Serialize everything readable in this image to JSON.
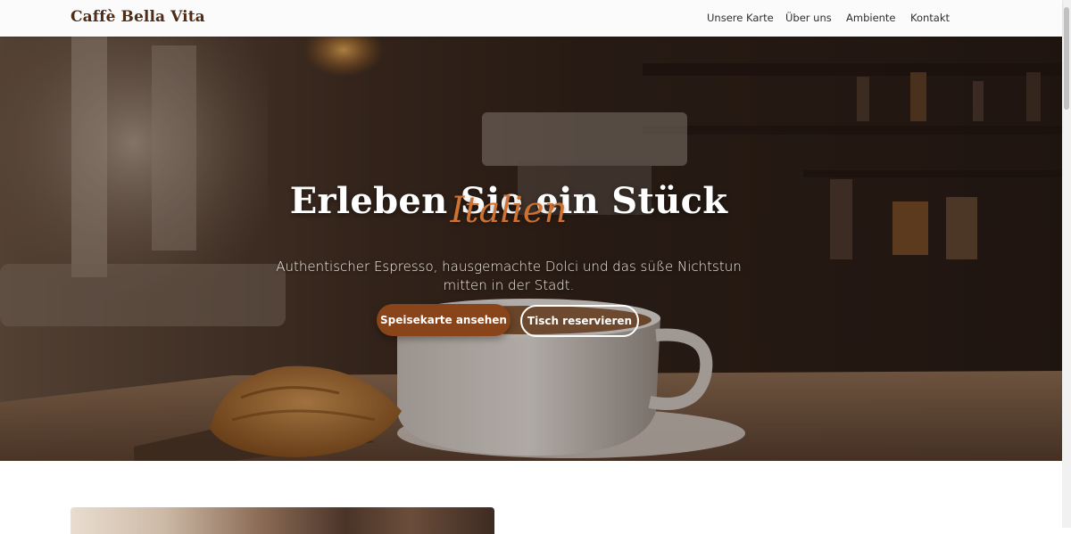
{
  "header": {
    "brand": "Caffè Bella Vita",
    "nav": [
      {
        "label": "Unsere Karte"
      },
      {
        "label": "Über uns"
      },
      {
        "label": "Ambiente"
      },
      {
        "label": "Kontakt"
      }
    ]
  },
  "hero": {
    "title": "Erleben Sie ein Stück",
    "title_accent": "Italien",
    "subtitle": "Authentischer Espresso, hausgemachte Dolci und das süße Nichtstun mitten in der Stadt.",
    "primary_button": "Speisekarte ansehen",
    "secondary_button": "Tisch reservieren"
  },
  "colors": {
    "brand": "#4e2c15",
    "accent": "#cd7232",
    "primary_button": "#8a4419"
  }
}
